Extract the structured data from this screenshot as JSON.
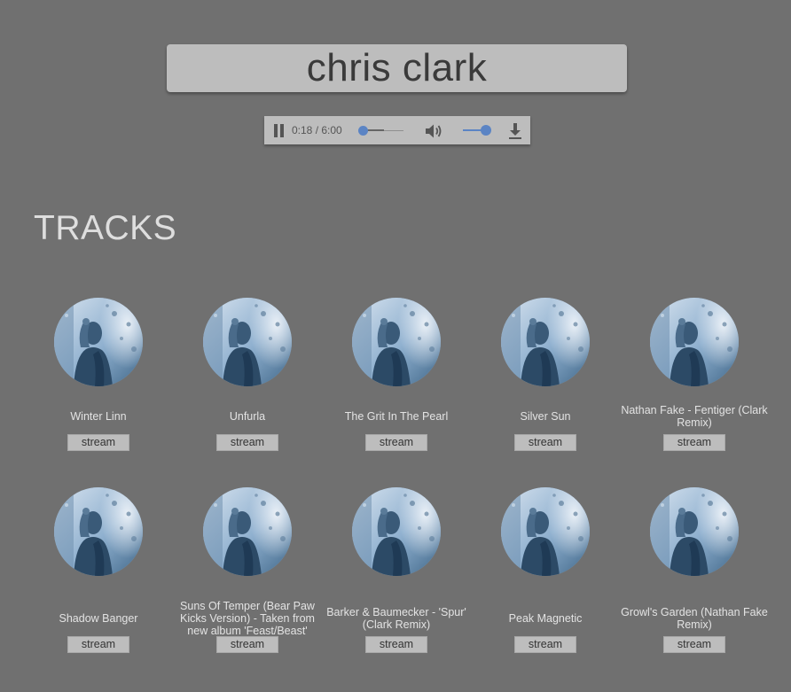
{
  "search": {
    "value": "chris clark"
  },
  "player": {
    "state": "playing",
    "time_display": "0:18 / 6:00",
    "progress": 0.05,
    "volume": 0.8,
    "accent_color": "#5b84c4",
    "pause_icon": "pause-icon",
    "volume_icon": "volume-icon",
    "download_icon": "download-icon"
  },
  "tracks_section": {
    "title": "TRACKS"
  },
  "tracks": [
    {
      "title": "Winter Linn",
      "button": "stream"
    },
    {
      "title": "Unfurla",
      "button": "stream"
    },
    {
      "title": "The Grit In The Pearl",
      "button": "stream"
    },
    {
      "title": "Silver Sun",
      "button": "stream"
    },
    {
      "title": "Nathan Fake - Fentiger (Clark Remix)",
      "button": "stream"
    },
    {
      "title": "Shadow Banger",
      "button": "stream"
    },
    {
      "title": "Suns Of Temper (Bear Paw Kicks Version) - Taken from new album 'Feast/Beast'",
      "button": "stream"
    },
    {
      "title": "Barker & Baumecker - 'Spur' (Clark Remix)",
      "button": "stream"
    },
    {
      "title": "Peak Magnetic",
      "button": "stream"
    },
    {
      "title": "Growl's Garden (Nathan Fake Remix)",
      "button": "stream"
    }
  ]
}
